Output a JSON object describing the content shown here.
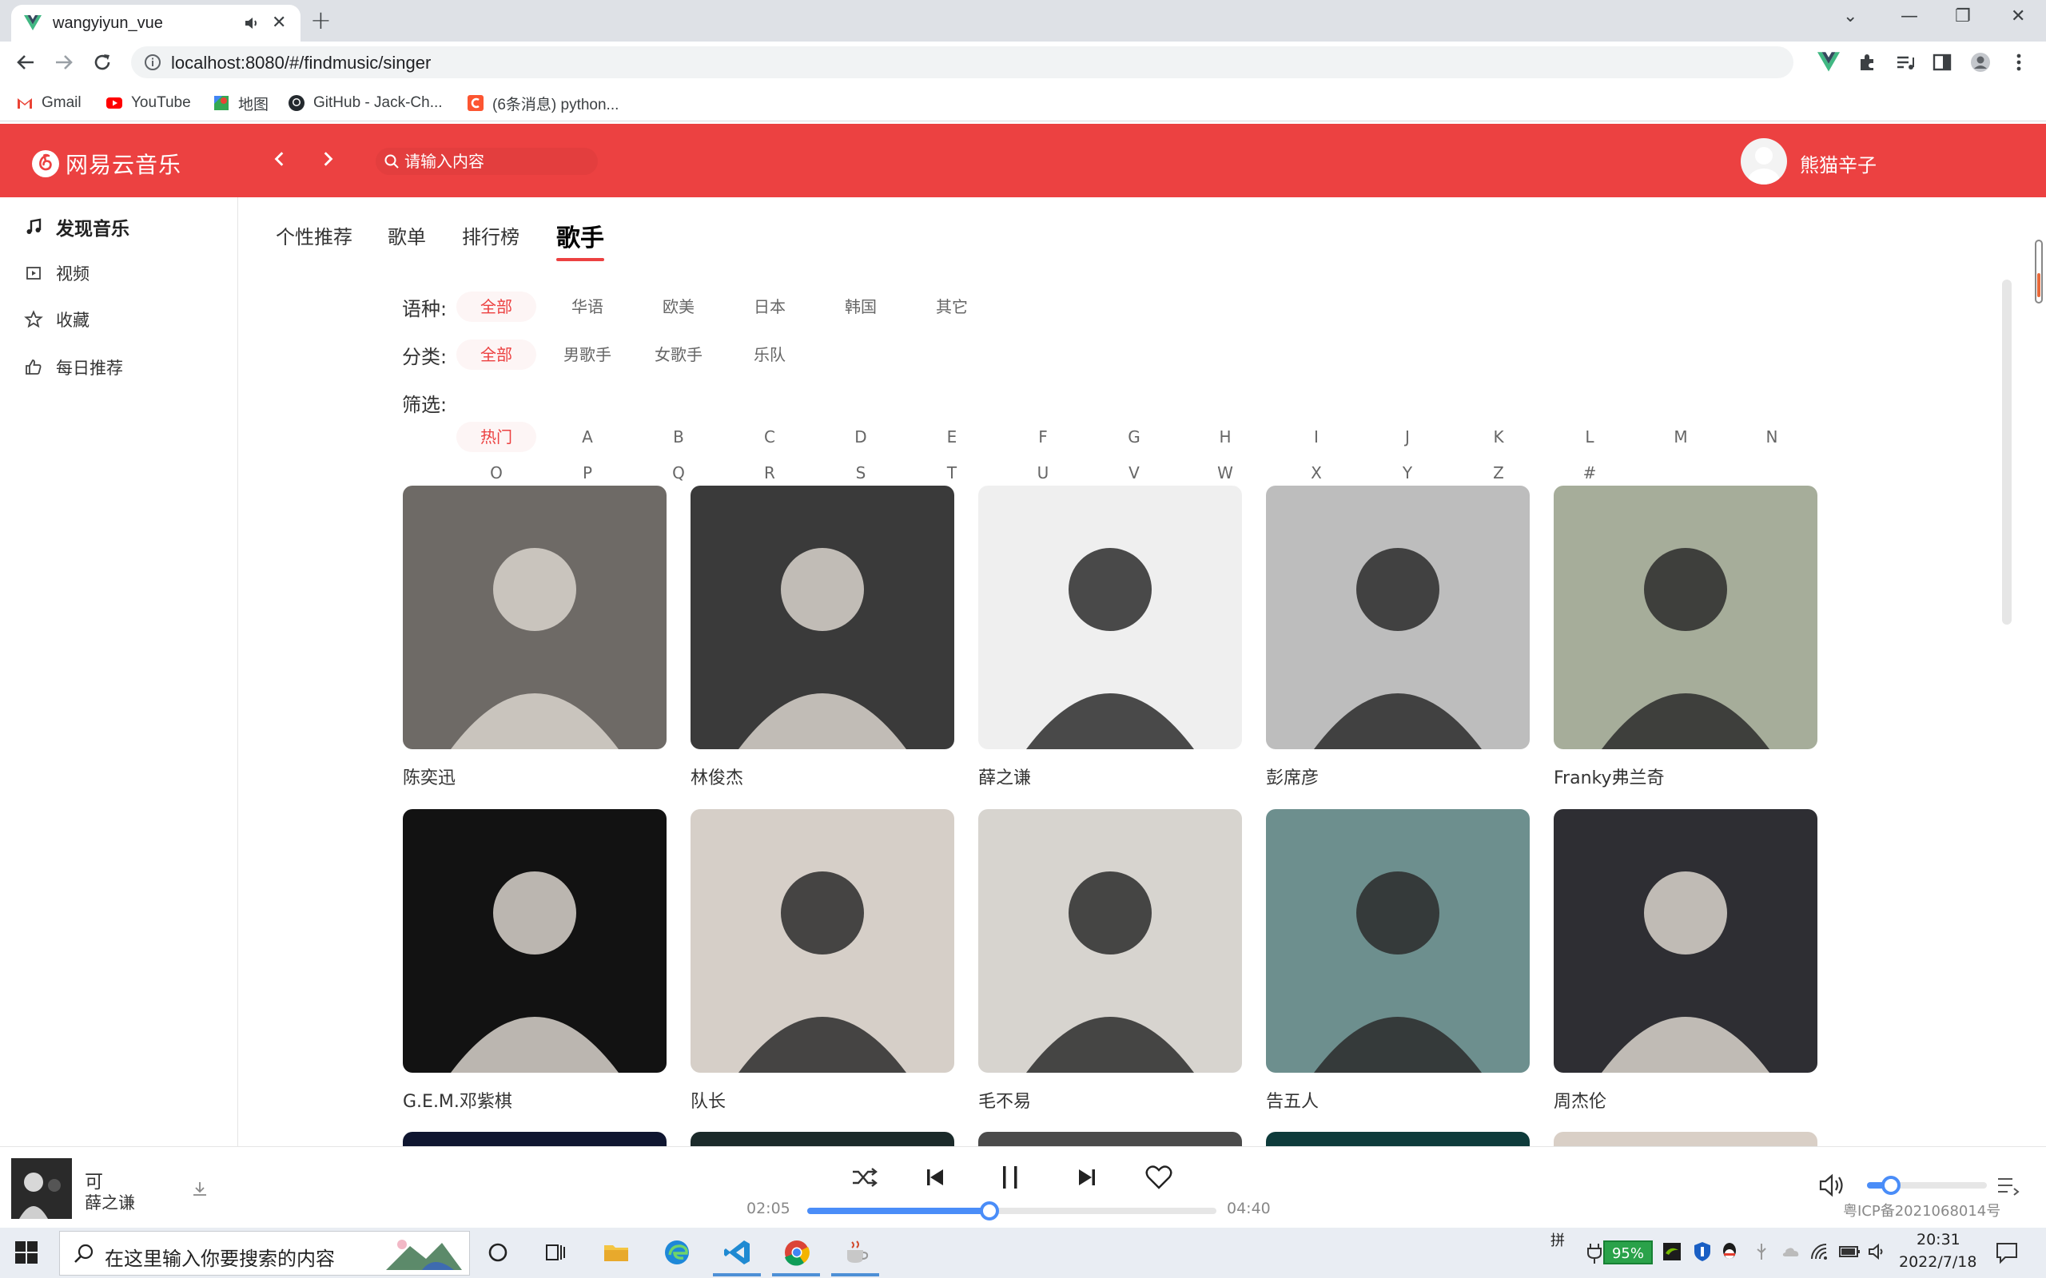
{
  "browser": {
    "tab_title": "wangyiyun_vue",
    "url": "localhost:8080/#/findmusic/singer",
    "bookmarks": [
      {
        "label": "Gmail",
        "icon": "gmail-icon",
        "color": "#ea4335"
      },
      {
        "label": "YouTube",
        "icon": "youtube-icon",
        "color": "#ff0000"
      },
      {
        "label": "地图",
        "icon": "maps-icon",
        "color": "#34a853"
      },
      {
        "label": "GitHub - Jack-Ch...",
        "icon": "github-icon",
        "color": "#24292e"
      },
      {
        "label": "(6条消息) python...",
        "icon": "csdn-icon",
        "color": "#fc5531"
      }
    ]
  },
  "header": {
    "logo_text": "网易云音乐",
    "search_placeholder": "请输入内容",
    "username": "熊猫辛子",
    "brand_color": "#ec4141"
  },
  "sidebar": {
    "items": [
      {
        "label": "发现音乐",
        "icon": "music-note-icon",
        "active": true
      },
      {
        "label": "视频",
        "icon": "video-icon",
        "active": false
      },
      {
        "label": "收藏",
        "icon": "star-icon",
        "active": false
      },
      {
        "label": "每日推荐",
        "icon": "thumbs-up-icon",
        "active": false
      }
    ]
  },
  "subnav": {
    "tabs": [
      {
        "label": "个性推荐",
        "active": false
      },
      {
        "label": "歌单",
        "active": false
      },
      {
        "label": "排行榜",
        "active": false
      },
      {
        "label": "歌手",
        "active": true
      }
    ]
  },
  "filters": {
    "language": {
      "label": "语种:",
      "options": [
        "全部",
        "华语",
        "欧美",
        "日本",
        "韩国",
        "其它"
      ],
      "selected": "全部"
    },
    "category": {
      "label": "分类:",
      "options": [
        "全部",
        "男歌手",
        "女歌手",
        "乐队"
      ],
      "selected": "全部"
    },
    "initial": {
      "label": "筛选:",
      "row1": [
        "热门",
        "A",
        "B",
        "C",
        "D",
        "E",
        "F",
        "G",
        "H",
        "I",
        "J",
        "K",
        "L",
        "M",
        "N"
      ],
      "row2": [
        "O",
        "P",
        "Q",
        "R",
        "S",
        "T",
        "U",
        "V",
        "W",
        "X",
        "Y",
        "Z",
        "#"
      ],
      "selected": "热门"
    }
  },
  "singers": [
    {
      "name": "陈奕迅",
      "bg": "#6e6a66"
    },
    {
      "name": "林俊杰",
      "bg": "#3a3a3a"
    },
    {
      "name": "薛之谦",
      "bg": "#efefef"
    },
    {
      "name": "彭席彦",
      "bg": "#bdbdbd"
    },
    {
      "name": "Franky弗兰奇",
      "bg": "#a6ad9a"
    },
    {
      "name": "G.E.M.邓紫棋",
      "bg": "#121212"
    },
    {
      "name": "队长",
      "bg": "#d6cfc8"
    },
    {
      "name": "毛不易",
      "bg": "#d7d4cf"
    },
    {
      "name": "告五人",
      "bg": "#6d8f8e"
    },
    {
      "name": "周杰伦",
      "bg": "#2e2e33"
    }
  ],
  "player": {
    "song_title": "可",
    "artist": "薛之谦",
    "current_time": "02:05",
    "total_time": "04:40",
    "progress": 0.446,
    "volume": 0.2,
    "icp": "粤ICP备2021068014号"
  },
  "taskbar": {
    "search_placeholder": "在这里输入你要搜索的内容",
    "ime": "拼",
    "battery": "95%",
    "time": "20:31",
    "date": "2022/7/18"
  }
}
